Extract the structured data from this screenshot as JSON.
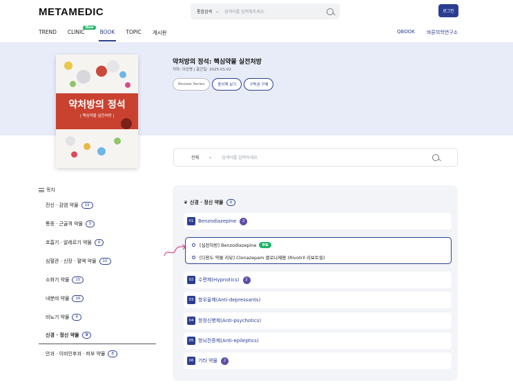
{
  "header": {
    "logo": "METAMEDIC",
    "search_scope": "통합검색",
    "search_placeholder": "검색어를 입력해주세요.",
    "login_label": "로그인"
  },
  "nav": {
    "items": [
      {
        "label": "TREND"
      },
      {
        "label": "CLINIC",
        "badge": "New"
      },
      {
        "label": "BOOK"
      },
      {
        "label": "TOPIC"
      },
      {
        "label": "게시판"
      }
    ],
    "right": [
      "QBOOK",
      "바른의학연구소"
    ]
  },
  "book": {
    "cover_title": "약처방의 정석",
    "cover_subtitle": "| 핵심약물 실전처방 |",
    "title": "약처방의 정석: 핵심약물 실전처방",
    "meta": "저자: 이상명 | 출간일: 2025-01-02",
    "buttons": [
      "Review Series",
      "종이책 보기",
      "구독권 구매"
    ]
  },
  "book_search": {
    "scope": "전체",
    "placeholder": "검색어를 입력하세요."
  },
  "toc": {
    "heading": "목차",
    "items": [
      {
        "label": "전신 · 감염 약물",
        "count": "19"
      },
      {
        "label": "통증 · 근골격 약물",
        "count": "5"
      },
      {
        "label": "호흡기 · 알레르기 약물",
        "count": "6"
      },
      {
        "label": "심혈관 · 신장 · 혈액 약물",
        "count": "10"
      },
      {
        "label": "소화기 약물",
        "count": "15"
      },
      {
        "label": "내분비 약물",
        "count": "16"
      },
      {
        "label": "비뇨기 약물",
        "count": "4"
      },
      {
        "label": "신경 · 정신 약물",
        "count": "9"
      },
      {
        "label": "안과 · 이비인후과 · 피부 약물",
        "count": "8"
      }
    ]
  },
  "section": {
    "title": "신경 · 정신 약물",
    "count": "9",
    "chapters": [
      {
        "num": "01",
        "label": "Benzodiazepine",
        "count": "2"
      },
      {
        "num": "02",
        "label": "수면제(Hypnotics)",
        "count": "2"
      },
      {
        "num": "03",
        "label": "항우울제(Anti-depressants)",
        "count": ""
      },
      {
        "num": "04",
        "label": "항정신병제(Anti-psychotics)",
        "count": ""
      },
      {
        "num": "05",
        "label": "항뇌전증제(Anti-epileptics)",
        "count": ""
      },
      {
        "num": "06",
        "label": "기타 약물",
        "count": "2"
      }
    ],
    "subitems": [
      {
        "label": "[실전처방] Benzodiazepine",
        "badge": "무료"
      },
      {
        "label": "[다용도 약물 리뷰] Clonazepam 클로나제팜 (Rivotril 리보트릴)",
        "badge": ""
      }
    ]
  },
  "colors": {
    "brand": "#2b3e91",
    "hero_bg": "#e8ecf8",
    "free_badge": "#20b36b",
    "cover_red": "#c9412f"
  }
}
